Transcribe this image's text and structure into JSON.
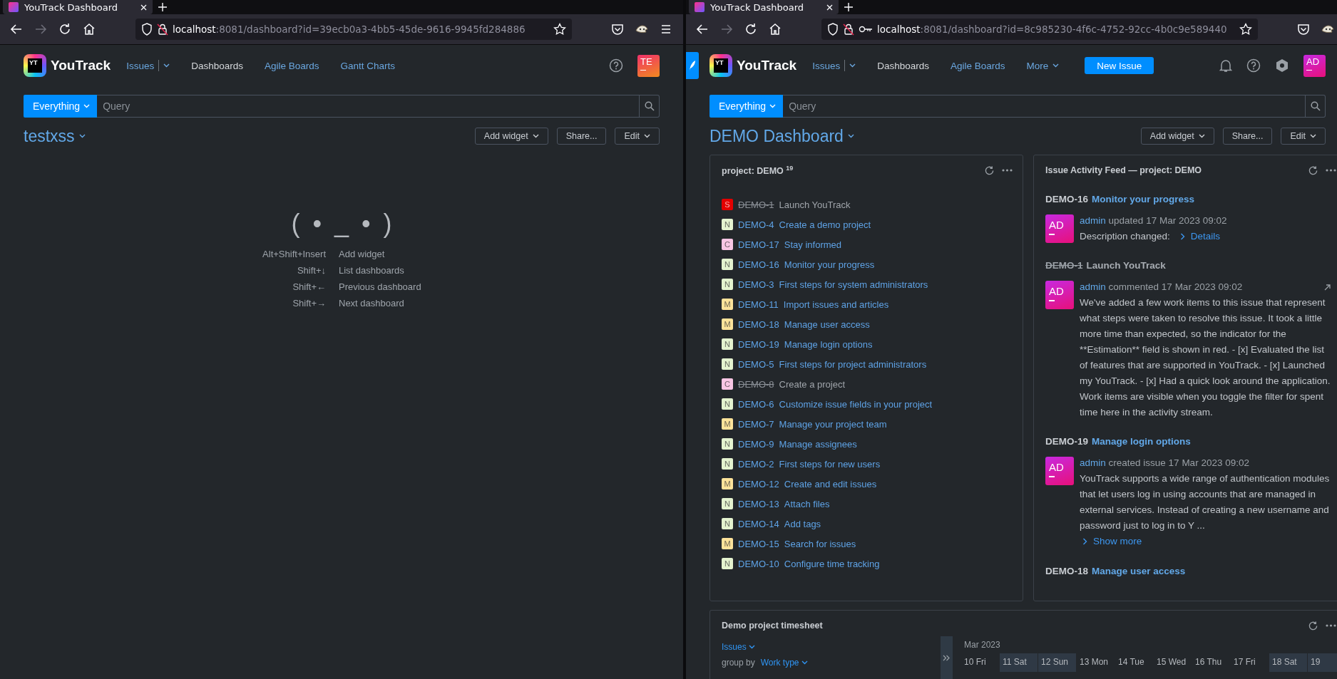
{
  "left_window": {
    "browser_tab": "YouTrack Dashboard",
    "url_host": "localhost",
    "url_path": ":8081/dashboard?id=39ecb0a3-4bb5-45de-9616-9945fd284886",
    "saved_login": false,
    "logo_mark": "YT",
    "app_name": "YouTrack",
    "nav": [
      {
        "label": "Issues",
        "kind": "split",
        "selected": false
      },
      {
        "label": "Dashboards",
        "kind": "link",
        "selected": true
      },
      {
        "label": "Agile Boards",
        "kind": "link",
        "selected": false
      },
      {
        "label": "Gantt Charts",
        "kind": "link",
        "selected": false
      }
    ],
    "avatar": "TE",
    "search": {
      "scope": "Everything",
      "placeholder": "Query"
    },
    "dashboard_title": "testxss",
    "actions": [
      {
        "label": "Add widget",
        "kind": "menu"
      },
      {
        "label": "Share...",
        "kind": "button"
      },
      {
        "label": "Edit",
        "kind": "menu"
      }
    ],
    "empty_state": {
      "face": "( • _ • )",
      "shortcuts": [
        {
          "keys": "Alt+Shift+Insert",
          "action": "Add widget"
        },
        {
          "keys": "Shift+↓",
          "action": "List dashboards"
        },
        {
          "keys": "Shift+←",
          "action": "Previous dashboard"
        },
        {
          "keys": "Shift+→",
          "action": "Next dashboard"
        }
      ]
    }
  },
  "right_window": {
    "browser_tab": "YouTrack Dashboard",
    "url_host": "localhost",
    "url_path": ":8081/dashboard?id=8c985230-4f6c-4752-92cc-4b0c9e589440",
    "saved_login": true,
    "logo_mark": "YT",
    "app_name": "YouTrack",
    "nav": [
      {
        "label": "Issues",
        "kind": "split",
        "selected": false
      },
      {
        "label": "Dashboards",
        "kind": "link",
        "selected": true
      },
      {
        "label": "Agile Boards",
        "kind": "link",
        "selected": false
      },
      {
        "label": "More",
        "kind": "menu",
        "selected": false
      }
    ],
    "new_issue": "New Issue",
    "avatar": "AD",
    "search": {
      "scope": "Everything",
      "placeholder": "Query"
    },
    "dashboard_title": "DEMO Dashboard",
    "actions": [
      {
        "label": "Add widget",
        "kind": "menu"
      },
      {
        "label": "Share...",
        "kind": "button"
      },
      {
        "label": "Edit",
        "kind": "menu"
      }
    ],
    "issue_list": {
      "title": "project: DEMO",
      "count": "19",
      "issues": [
        {
          "badge": "S",
          "color": "#e30000",
          "id": "DEMO-1",
          "summary": "Launch YouTrack",
          "resolved": true
        },
        {
          "badge": "N",
          "color": "#e4f3cf",
          "id": "DEMO-4",
          "summary": "Create a demo project",
          "resolved": false
        },
        {
          "badge": "C",
          "color": "#f9c6e4",
          "id": "DEMO-17",
          "summary": "Stay informed",
          "resolved": false
        },
        {
          "badge": "N",
          "color": "#e4f3cf",
          "id": "DEMO-16",
          "summary": "Monitor your progress",
          "resolved": false
        },
        {
          "badge": "N",
          "color": "#e4f3cf",
          "id": "DEMO-3",
          "summary": "First steps for system administrators",
          "resolved": false
        },
        {
          "badge": "M",
          "color": "#fde39a",
          "id": "DEMO-11",
          "summary": "Import issues and articles",
          "resolved": false
        },
        {
          "badge": "M",
          "color": "#fde39a",
          "id": "DEMO-18",
          "summary": "Manage user access",
          "resolved": false
        },
        {
          "badge": "N",
          "color": "#e4f3cf",
          "id": "DEMO-19",
          "summary": "Manage login options",
          "resolved": false
        },
        {
          "badge": "N",
          "color": "#e4f3cf",
          "id": "DEMO-5",
          "summary": "First steps for project administrators",
          "resolved": false
        },
        {
          "badge": "C",
          "color": "#f9c6e4",
          "id": "DEMO-8",
          "summary": "Create a project",
          "resolved": true
        },
        {
          "badge": "N",
          "color": "#e4f3cf",
          "id": "DEMO-6",
          "summary": "Customize issue fields in your project",
          "resolved": false
        },
        {
          "badge": "M",
          "color": "#fde39a",
          "id": "DEMO-7",
          "summary": "Manage your project team",
          "resolved": false
        },
        {
          "badge": "N",
          "color": "#e4f3cf",
          "id": "DEMO-9",
          "summary": "Manage assignees",
          "resolved": false
        },
        {
          "badge": "N",
          "color": "#e4f3cf",
          "id": "DEMO-2",
          "summary": "First steps for new users",
          "resolved": false
        },
        {
          "badge": "M",
          "color": "#fde39a",
          "id": "DEMO-12",
          "summary": "Create and edit issues",
          "resolved": false
        },
        {
          "badge": "N",
          "color": "#e4f3cf",
          "id": "DEMO-13",
          "summary": "Attach files",
          "resolved": false
        },
        {
          "badge": "N",
          "color": "#e4f3cf",
          "id": "DEMO-14",
          "summary": "Add tags",
          "resolved": false
        },
        {
          "badge": "M",
          "color": "#fde39a",
          "id": "DEMO-15",
          "summary": "Search for issues",
          "resolved": false
        },
        {
          "badge": "N",
          "color": "#e4f3cf",
          "id": "DEMO-10",
          "summary": "Configure time tracking",
          "resolved": false
        }
      ]
    },
    "activity_feed": {
      "title": "Issue Activity Feed — project: DEMO",
      "entries": [
        {
          "kind": "change",
          "id": "DEMO-16",
          "resolved": false,
          "summary": "Monitor your progress",
          "avatar": "AD",
          "author": "admin",
          "action": "updated",
          "date": "17 Mar 2023 09:02",
          "text": "Description changed:",
          "link": "Details"
        },
        {
          "kind": "comment",
          "id": "DEMO-1",
          "resolved": true,
          "summary": "Launch YouTrack",
          "avatar": "AD",
          "author": "admin",
          "action": "commented",
          "date": "17 Mar 2023 09:02",
          "text": "We've added a few work items to this issue that represent what steps were taken to resolve this issue. It took a little more time than expected, so the indicator for the **Estimation** field is shown in red. - [x] Evaluated the list of features that are supported in YouTrack. - [x] Launched my YouTrack. - [x] Had a quick look around the application. Work items are visible when you toggle the filter for spent time here in the activity stream."
        },
        {
          "kind": "created",
          "id": "DEMO-19",
          "resolved": false,
          "summary": "Manage login options",
          "avatar": "AD",
          "author": "admin",
          "action": "created issue",
          "date": "17 Mar 2023 09:02",
          "text": "YouTrack supports a wide range of authentication modules that let users log in using accounts that are managed in external services. Instead of creating a new username and password just to log in to Y ...",
          "link": "Show more"
        },
        {
          "kind": "heading",
          "id": "DEMO-18",
          "resolved": false,
          "summary": "Manage user access"
        }
      ]
    },
    "timesheet": {
      "title": "Demo project timesheet",
      "rows_selector": "Issues",
      "group_by_label": "group by",
      "group_by": "Work type",
      "month": "Mar 2023",
      "days": [
        {
          "label": "10 Fri",
          "weekend": false
        },
        {
          "label": "11 Sat",
          "weekend": true
        },
        {
          "label": "12 Sun",
          "weekend": true
        },
        {
          "label": "13 Mon",
          "weekend": false
        },
        {
          "label": "14 Tue",
          "weekend": false
        },
        {
          "label": "15 Wed",
          "weekend": false
        },
        {
          "label": "16 Thu",
          "weekend": false
        },
        {
          "label": "17 Fri",
          "weekend": false
        },
        {
          "label": "18 Sat",
          "weekend": true
        },
        {
          "label": "19",
          "weekend": true
        }
      ]
    }
  }
}
